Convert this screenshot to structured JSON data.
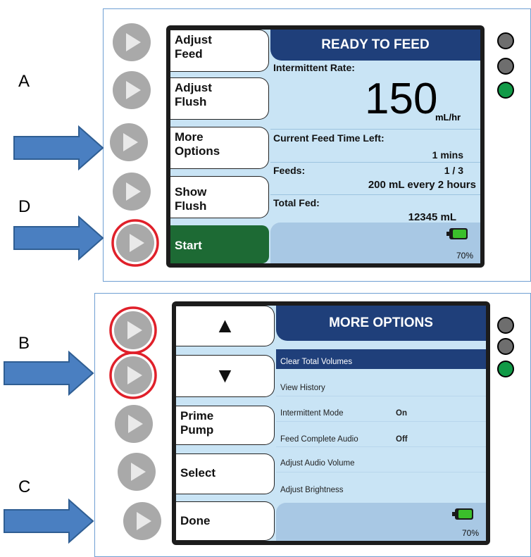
{
  "labels": {
    "a": "A",
    "b": "B",
    "c": "C",
    "d": "D"
  },
  "colors": {
    "arrow": "#4a7fc1",
    "header": "#1f3f7a",
    "screen_bg": "#c9e4f5",
    "start": "#1d6a34",
    "led_gray": "#6e6e6e",
    "led_green": "#119a47",
    "highlight_ring": "#e0202a"
  },
  "icons": {
    "physical_button": "play-triangle-icon",
    "battery": "battery-icon",
    "up": "up-triangle-icon",
    "down": "down-triangle-icon"
  },
  "top_screen": {
    "softkeys": [
      {
        "line1": "Adjust",
        "line2": "Feed"
      },
      {
        "line1": "Adjust",
        "line2": "Flush"
      },
      {
        "line1": "More",
        "line2": "Options"
      },
      {
        "line1": "Show",
        "line2": "Flush"
      },
      {
        "line1": "Start",
        "line2": ""
      }
    ],
    "title": "READY TO FEED",
    "rate_label": "Intermittent Rate:",
    "rate_value": "150",
    "rate_unit": "mL/hr",
    "time_label": "Current Feed Time Left:",
    "time_value": "1 mins",
    "feeds_label": "Feeds:",
    "feeds_count": "1 / 3",
    "feeds_schedule": "200 mL every 2 hours",
    "total_label": "Total Fed:",
    "total_value": "12345 mL",
    "battery": "70%"
  },
  "bottom_screen": {
    "softkeys": [
      {
        "line1": "▲",
        "line2": ""
      },
      {
        "line1": "▼",
        "line2": ""
      },
      {
        "line1": "Prime",
        "line2": "Pump"
      },
      {
        "line1": "Select",
        "line2": ""
      },
      {
        "line1": "Done",
        "line2": ""
      }
    ],
    "title": "MORE OPTIONS",
    "menu": [
      {
        "label": "Clear Total Volumes",
        "value": ""
      },
      {
        "label": "View History",
        "value": ""
      },
      {
        "label": "Intermittent Mode",
        "value": "On"
      },
      {
        "label": "Feed Complete Audio",
        "value": "Off"
      },
      {
        "label": "Adjust Audio Volume",
        "value": ""
      },
      {
        "label": "Adjust Brightness",
        "value": ""
      }
    ],
    "battery": "70%"
  },
  "leds": [
    "gray",
    "gray",
    "green"
  ]
}
